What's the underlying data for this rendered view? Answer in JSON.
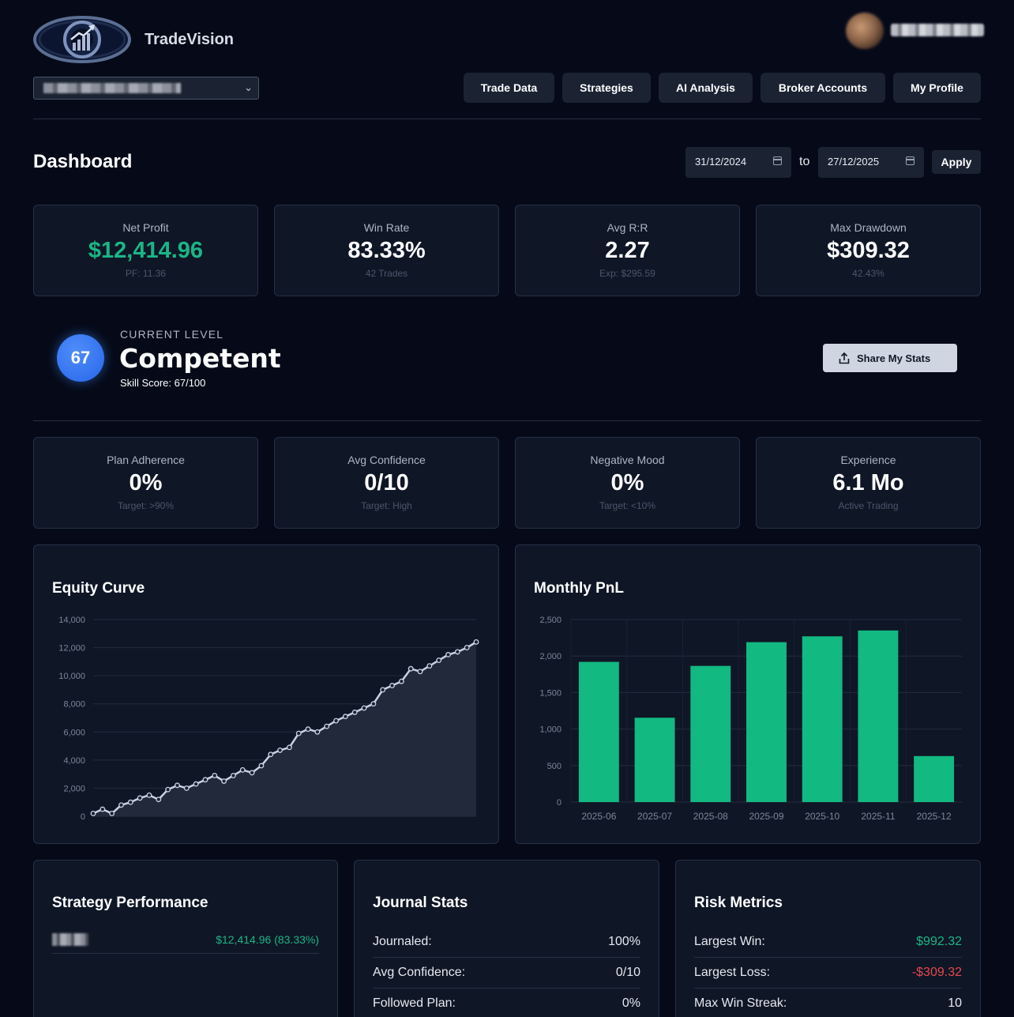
{
  "app": {
    "name": "TradeVision"
  },
  "nav": [
    "Trade Data",
    "Strategies",
    "AI Analysis",
    "Broker Accounts",
    "My Profile"
  ],
  "dashboard": {
    "title": "Dashboard",
    "date_from": "31/12/2024",
    "to_label": "to",
    "date_to": "27/12/2025",
    "apply_label": "Apply"
  },
  "stats_top": [
    {
      "label": "Net Profit",
      "value": "$12,414.96",
      "sub": "PF: 11.36",
      "color": "#19b685"
    },
    {
      "label": "Win Rate",
      "value": "83.33%",
      "sub": "42 Trades"
    },
    {
      "label": "Avg R:R",
      "value": "2.27",
      "sub": "Exp: $295.59"
    },
    {
      "label": "Max Drawdown",
      "value": "$309.32",
      "sub": "42.43%"
    }
  ],
  "level": {
    "score_badge": "67",
    "caption": "CURRENT LEVEL",
    "name": "Competent",
    "skill_text": "Skill Score: 67/100",
    "share_label": "Share My Stats"
  },
  "stats_bottom": [
    {
      "label": "Plan Adherence",
      "value": "0%",
      "sub": "Target: >90%"
    },
    {
      "label": "Avg Confidence",
      "value": "0/10",
      "sub": "Target: High"
    },
    {
      "label": "Negative Mood",
      "value": "0%",
      "sub": "Target: <10%"
    },
    {
      "label": "Experience",
      "value": "6.1 Mo",
      "sub": "Active Trading"
    }
  ],
  "chart_data": [
    {
      "type": "area",
      "title": "Equity Curve",
      "ylim": [
        0,
        14000
      ],
      "yticks": [
        "0",
        "2,000",
        "4,000",
        "6,000",
        "8,000",
        "10,000",
        "12,000",
        "14,000"
      ],
      "values": [
        200,
        500,
        200,
        800,
        1000,
        1300,
        1500,
        1200,
        1900,
        2200,
        2000,
        2300,
        2600,
        2900,
        2500,
        2900,
        3300,
        3100,
        3600,
        4400,
        4700,
        4900,
        5900,
        6200,
        6000,
        6400,
        6800,
        7100,
        7400,
        7700,
        8000,
        9000,
        9300,
        9600,
        10500,
        10300,
        10700,
        11100,
        11500,
        11700,
        12000,
        12400
      ],
      "colors": {
        "line": "#c7d2e3",
        "fill": "#232b3d"
      }
    },
    {
      "type": "bar",
      "title": "Monthly PnL",
      "categories": [
        "2025-06",
        "2025-07",
        "2025-08",
        "2025-09",
        "2025-10",
        "2025-11",
        "2025-12"
      ],
      "values": [
        1920,
        1155,
        1865,
        2190,
        2270,
        2350,
        630
      ],
      "ylim": [
        0,
        2500
      ],
      "yticks": [
        "0",
        "500",
        "1,000",
        "1,500",
        "2,000",
        "2,500"
      ],
      "colors": {
        "bar": "#12b981"
      }
    }
  ],
  "strategy": {
    "title": "Strategy Performance",
    "value": "$12,414.96 (83.33%)"
  },
  "journal": {
    "title": "Journal Stats",
    "rows": [
      {
        "k": "Journaled:",
        "v": "100%"
      },
      {
        "k": "Avg Confidence:",
        "v": "0/10"
      },
      {
        "k": "Followed Plan:",
        "v": "0%"
      }
    ]
  },
  "risk": {
    "title": "Risk Metrics",
    "rows": [
      {
        "k": "Largest Win:",
        "v": "$992.32"
      },
      {
        "k": "Largest Loss:",
        "v": "-$309.32"
      },
      {
        "k": "Max Win Streak:",
        "v": "10"
      }
    ]
  }
}
